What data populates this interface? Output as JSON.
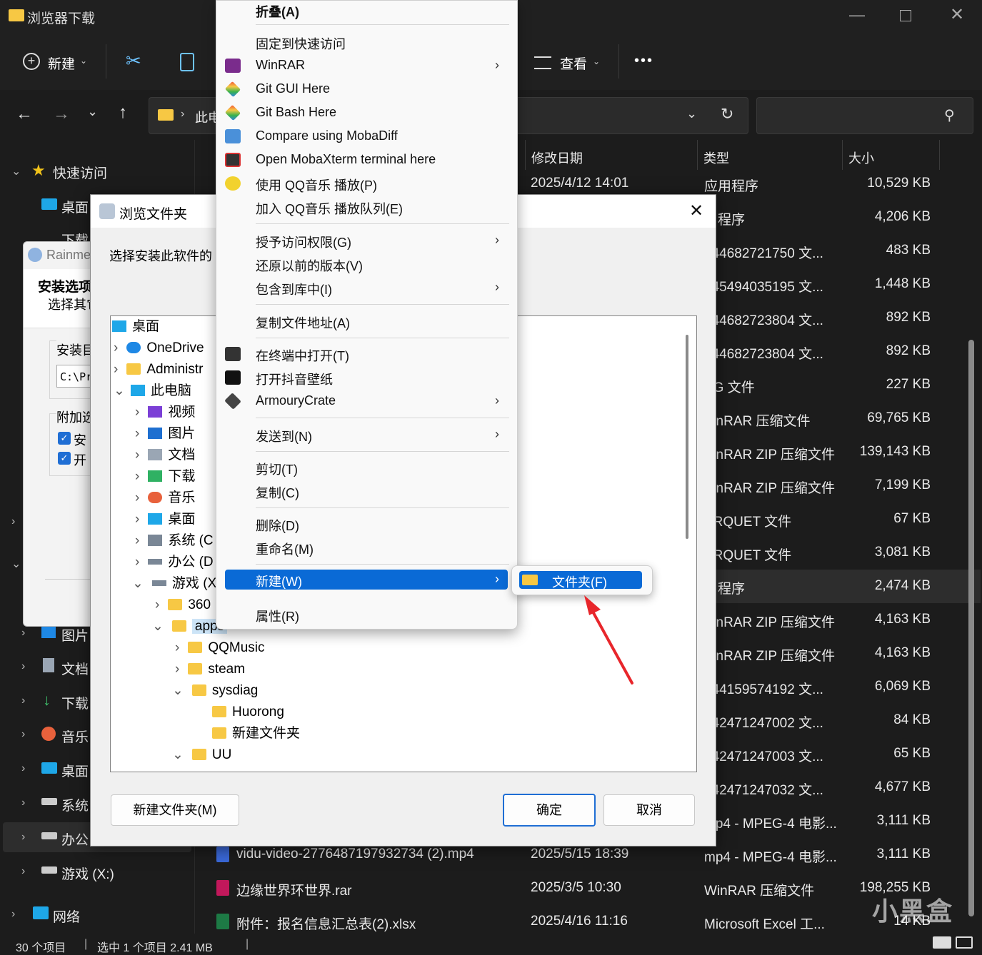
{
  "window": {
    "title": "浏览器下载"
  },
  "toolbar": {
    "new_label": "新建",
    "view_label": "查看",
    "more_label": "•••"
  },
  "address": {
    "path_text": "此电"
  },
  "columns": {
    "date": "修改日期",
    "type": "类型",
    "size": "大小"
  },
  "files": [
    {
      "name": "",
      "date": "2025/4/12 14:01",
      "type": "应用程序",
      "size": "10,529 KB"
    },
    {
      "name": "",
      "date": "",
      "type": "用程序",
      "size": "4,206 KB"
    },
    {
      "name": "",
      "date": "",
      "type": "744682721750 文...",
      "size": "483 KB"
    },
    {
      "name": "",
      "date": "",
      "type": "745494035195 文...",
      "size": "1,448 KB"
    },
    {
      "name": "",
      "date": "",
      "type": "744682723804 文...",
      "size": "892 KB"
    },
    {
      "name": "",
      "date": "",
      "type": "744682723804 文...",
      "size": "892 KB"
    },
    {
      "name": "",
      "date": "",
      "type": "PG 文件",
      "size": "227 KB"
    },
    {
      "name": "",
      "date": "",
      "type": "VinRAR 压缩文件",
      "size": "69,765 KB"
    },
    {
      "name": "",
      "date": "",
      "type": "VinRAR ZIP 压缩文件",
      "size": "139,143 KB"
    },
    {
      "name": "",
      "date": "",
      "type": "VinRAR ZIP 压缩文件",
      "size": "7,199 KB"
    },
    {
      "name": "",
      "date": "",
      "type": "ARQUET 文件",
      "size": "67 KB"
    },
    {
      "name": "",
      "date": "",
      "type": "ARQUET 文件",
      "size": "3,081 KB"
    },
    {
      "name": "",
      "date": "",
      "type": "用程序",
      "size": "2,474 KB"
    },
    {
      "name": "",
      "date": "",
      "type": "VinRAR ZIP 压缩文件",
      "size": "4,163 KB"
    },
    {
      "name": "",
      "date": "",
      "type": "VinRAR ZIP 压缩文件",
      "size": "4,163 KB"
    },
    {
      "name": "",
      "date": "",
      "type": "744159574192 文...",
      "size": "6,069 KB"
    },
    {
      "name": "",
      "date": "",
      "type": "742471247002 文...",
      "size": "84 KB"
    },
    {
      "name": "",
      "date": "",
      "type": "742471247003 文...",
      "size": "65 KB"
    },
    {
      "name": "",
      "date": "",
      "type": "742471247032 文...",
      "size": "4,677 KB"
    },
    {
      "name": "",
      "date": "",
      "type": "mp4 - MPEG-4 电影...",
      "size": "3,111 KB"
    },
    {
      "name": "vidu-video-2776487197932734 (2).mp4",
      "date": "2025/5/15 18:39",
      "type": "mp4 - MPEG-4 电影...",
      "size": "3,111 KB"
    },
    {
      "name": "边缘世界环世界.rar",
      "date": "2025/3/5 10:30",
      "type": "WinRAR 压缩文件",
      "size": "198,255 KB"
    },
    {
      "name": "附件：报名信息汇总表(2).xlsx",
      "date": "2025/4/16 11:16",
      "type": "Microsoft Excel 工...",
      "size": "14 KB"
    }
  ],
  "sidebar": {
    "quick_access": "快速访问",
    "desktop": "桌面",
    "downloads_partial": "下载",
    "pictures": "图片",
    "documents": "文档",
    "downloads": "下载",
    "music": "音乐",
    "desktop2": "桌面",
    "system": "系统",
    "office": "办公",
    "games": "游戏 (X:)",
    "network": "网络"
  },
  "status": {
    "count": "30 个项目",
    "selected": "选中 1 个项目 2.41 MB"
  },
  "rainmeter": {
    "title": "Rainme",
    "heading": "安装选项",
    "subheading": "选择其它",
    "install_dir_label": "安装目",
    "path_value": "C:\\Pr",
    "extra_label": "附加选",
    "opt1": "安",
    "opt2": "开"
  },
  "browse": {
    "title": "浏览文件夹",
    "instruction": "选择安装此软件的",
    "tree": {
      "desktop": "桌面",
      "onedrive": "OneDrive",
      "admin": "Administr",
      "thispc": "此电脑",
      "video": "视频",
      "pictures": "图片",
      "documents": "文档",
      "downloads": "下载",
      "music": "音乐",
      "system": "系统 (C",
      "office": "办公 (D",
      "games": "游戏 (X",
      "f360": "360",
      "apps": "apps",
      "qqmusic": "QQMusic",
      "steam": "steam",
      "sysdiag": "sysdiag",
      "huorong": "Huorong",
      "newfolder": "新建文件夹",
      "uu": "UU"
    },
    "new_folder_btn": "新建文件夹(M)",
    "ok_btn": "确定",
    "cancel_btn": "取消"
  },
  "context_menu": {
    "collapse": "折叠(A)",
    "pin_quick": "固定到快速访问",
    "winrar": "WinRAR",
    "git_gui": "Git GUI Here",
    "git_bash": "Git Bash Here",
    "mobadiff": "Compare using MobaDiff",
    "mobaxterm": "Open MobaXterm terminal here",
    "qq_play": "使用 QQ音乐 播放(P)",
    "qq_queue": "加入 QQ音乐 播放队列(E)",
    "grant_access": "授予访问权限(G)",
    "restore": "还原以前的版本(V)",
    "include_library": "包含到库中(I)",
    "copy_path": "复制文件地址(A)",
    "open_terminal": "在终端中打开(T)",
    "douyin": "打开抖音壁纸",
    "armoury": "ArmouryCrate",
    "send_to": "发送到(N)",
    "cut": "剪切(T)",
    "copy": "复制(C)",
    "delete": "删除(D)",
    "rename": "重命名(M)",
    "new": "新建(W)",
    "properties": "属性(R)"
  },
  "submenu": {
    "folder": "文件夹(F)"
  },
  "watermark": "小黑盒",
  "colors": {
    "highlight": "#0a6ad6",
    "folder": "#f7c844",
    "arrow": "#e8262b"
  }
}
